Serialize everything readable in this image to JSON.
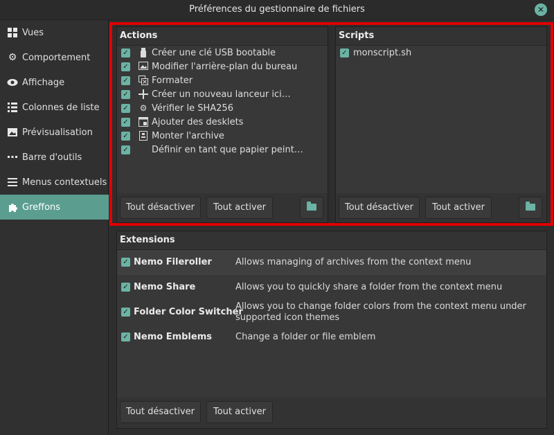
{
  "window": {
    "title": "Préférences du gestionnaire de fichiers"
  },
  "sidebar": {
    "items": [
      {
        "label": "Vues",
        "icon": "grid-icon"
      },
      {
        "label": "Comportement",
        "icon": "gear-icon"
      },
      {
        "label": "Affichage",
        "icon": "eye-icon"
      },
      {
        "label": "Colonnes de liste",
        "icon": "list-icon"
      },
      {
        "label": "Prévisualisation",
        "icon": "image-icon"
      },
      {
        "label": "Barre d'outils",
        "icon": "toolbar-icon"
      },
      {
        "label": "Menus contextuels",
        "icon": "menu-icon"
      },
      {
        "label": "Greffons",
        "icon": "puzzle-icon"
      }
    ],
    "active": "Greffons"
  },
  "actions": {
    "title": "Actions",
    "items": [
      {
        "label": "Créer une clé USB bootable",
        "icon": "usb-icon",
        "checked": true
      },
      {
        "label": "Modifier l'arrière-plan du bureau",
        "icon": "wallpaper-icon",
        "checked": true
      },
      {
        "label": "Formater",
        "icon": "format-icon",
        "checked": true
      },
      {
        "label": "Créer un nouveau lanceur ici…",
        "icon": "plus-icon",
        "checked": true
      },
      {
        "label": "Vérifier le SHA256",
        "icon": "verify-icon",
        "checked": true
      },
      {
        "label": "Ajouter des desklets",
        "icon": "desklet-icon",
        "checked": true
      },
      {
        "label": "Monter l'archive",
        "icon": "archive-icon",
        "checked": true
      },
      {
        "label": "Définir en tant que papier peint…",
        "icon": "",
        "checked": true
      }
    ],
    "disable_all": "Tout désactiver",
    "enable_all": "Tout activer"
  },
  "scripts": {
    "title": "Scripts",
    "items": [
      {
        "label": "monscript.sh",
        "checked": true
      }
    ],
    "disable_all": "Tout désactiver",
    "enable_all": "Tout activer"
  },
  "extensions": {
    "title": "Extensions",
    "items": [
      {
        "name": "Nemo Fileroller",
        "desc": "Allows managing of archives from the context menu",
        "checked": true
      },
      {
        "name": "Nemo Share",
        "desc": "Allows you to quickly share a folder from the context menu",
        "checked": true
      },
      {
        "name": "Folder Color Switcher",
        "desc": "Allows you to change folder colors from the context menu under supported icon themes",
        "checked": true
      },
      {
        "name": "Nemo Emblems",
        "desc": "Change a folder or file emblem",
        "checked": true
      }
    ],
    "disable_all": "Tout désactiver",
    "enable_all": "Tout activer"
  },
  "colors": {
    "accent": "#6bb3a4",
    "highlight_border": "#e00000"
  }
}
